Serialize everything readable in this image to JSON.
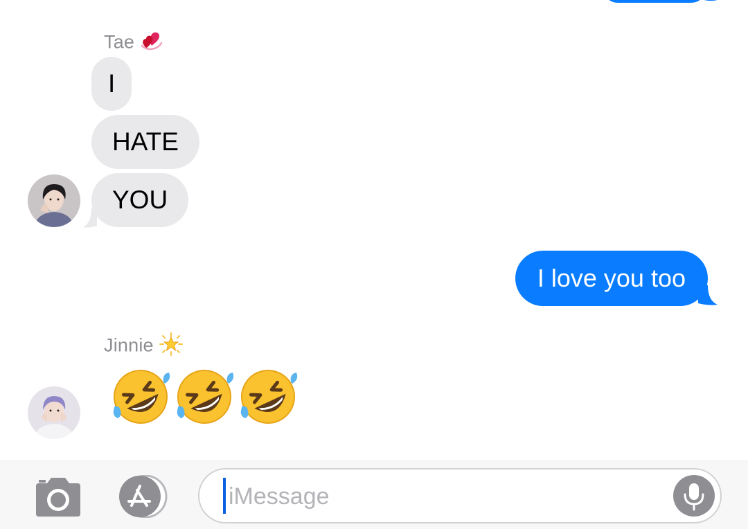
{
  "conversation": {
    "groups": [
      {
        "sender": "Tae",
        "sender_emoji": "two-hearts-icon",
        "avatar": "tae-avatar",
        "messages": [
          "I",
          "HATE",
          "YOU"
        ]
      },
      {
        "sender": "Jinnie",
        "sender_emoji": "glowing-star-icon",
        "avatar": "jinnie-avatar",
        "messages": [
          "rolling-on-floor-laughing-emoji x3"
        ]
      }
    ],
    "outgoing": [
      "I love you too"
    ]
  },
  "input": {
    "placeholder": "iMessage",
    "camera_icon": "camera-icon",
    "apps_icon": "app-store-icon",
    "mic_icon": "microphone-icon"
  },
  "colors": {
    "outgoing_bubble": "#0a7cff",
    "incoming_bubble": "#e9e9eb",
    "sender_name": "#8e8e93",
    "caret": "#0a60e0"
  }
}
